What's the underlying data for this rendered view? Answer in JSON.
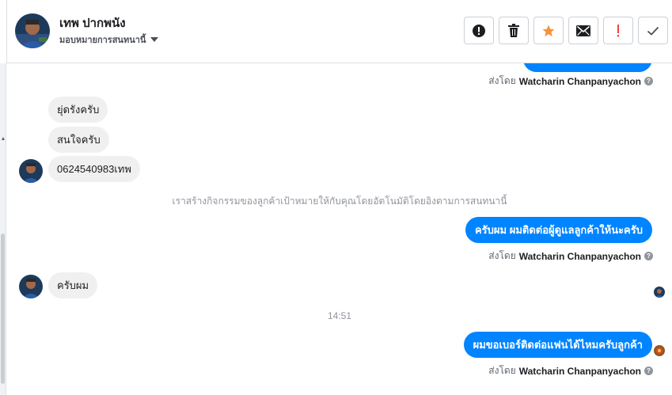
{
  "header": {
    "contact_name": "เทพ ปากพนัง",
    "assign_label": "มอบหมายการสนทนานี้",
    "actions": [
      {
        "name": "report-spam-button",
        "icon": "alert-circle-icon"
      },
      {
        "name": "delete-button",
        "icon": "trash-icon"
      },
      {
        "name": "star-button",
        "icon": "star-icon",
        "color": "#f7923b"
      },
      {
        "name": "mark-unread-button",
        "icon": "envelope-icon"
      },
      {
        "name": "flag-follow-up-button",
        "icon": "exclamation-icon",
        "color": "#fa3e3e"
      },
      {
        "name": "mark-done-button",
        "icon": "checkmark-icon"
      }
    ]
  },
  "conversation": {
    "sent_by_prefix": "ส่งโดย",
    "sender_name": "Watcharin Chanpanyachon",
    "incoming_1": [
      "ยุ่ดรังครับ",
      "สนใจครับ",
      "0624540983เทพ"
    ],
    "system_note": "เราสร้างกิจกรรมของลูกค้าเป้าหมายให้กับคุณโดยอัตโนมัติโดยอิงตามการสนทนานี้",
    "outgoing_1": "ครับผม ผมติดต่อผู้ดูแลลูกค้าให้นะครับ",
    "incoming_2": "ครับผม",
    "time_divider": "14:51",
    "outgoing_2": "ผมขอเบอร์ติดต่อแฟนได้ไหมครับลูกค้า"
  },
  "colors": {
    "outgoing_bubble": "#0084ff",
    "incoming_bubble": "#f1f0f0",
    "star": "#f7923b",
    "flag": "#fa3e3e"
  }
}
